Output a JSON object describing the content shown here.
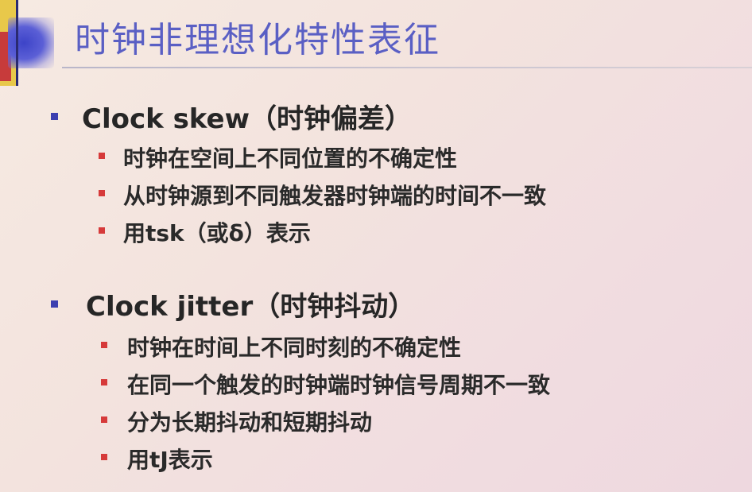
{
  "title": "时钟非理想化特性表征",
  "sections": [
    {
      "heading": "Clock skew（时钟偏差）",
      "items": [
        "时钟在空间上不同位置的不确定性",
        "从时钟源到不同触发器时钟端的时间不一致",
        "用tsk（或δ）表示"
      ]
    },
    {
      "heading": "Clock jitter（时钟抖动）",
      "items": [
        "时钟在时间上不同时刻的不确定性",
        "在同一个触发的时钟端时钟信号周期不一致",
        "分为长期抖动和短期抖动",
        "用tJ表示"
      ]
    }
  ]
}
